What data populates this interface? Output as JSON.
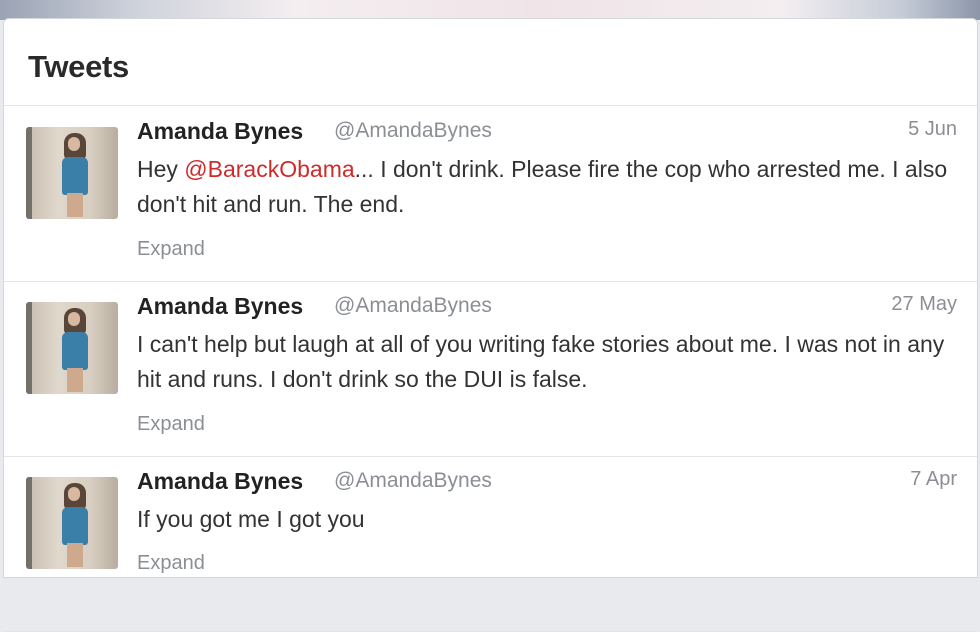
{
  "panel": {
    "title": "Tweets"
  },
  "tweets": [
    {
      "name": "Amanda Bynes",
      "handle": "@AmandaBynes",
      "time": "5 Jun",
      "text_before": "Hey ",
      "mention": "@BarackObama",
      "text_after": "... I don't drink. Please fire the cop who arrested me. I also don't hit and run. The end.",
      "expand": "Expand"
    },
    {
      "name": "Amanda Bynes",
      "handle": "@AmandaBynes",
      "time": "27 May",
      "text": "I can't help but laugh at all of you writing fake stories about me. I was not in any hit and runs. I don't drink so the DUI is false.",
      "expand": "Expand"
    },
    {
      "name": "Amanda Bynes",
      "handle": "@AmandaBynes",
      "time": "7 Apr",
      "text": "If you got me I got you",
      "expand": "Expand"
    }
  ],
  "colors": {
    "mention": "#d02b2b",
    "muted": "#8b8f95",
    "text": "#333333"
  },
  "icons": {
    "avatar": "profile-photo"
  }
}
